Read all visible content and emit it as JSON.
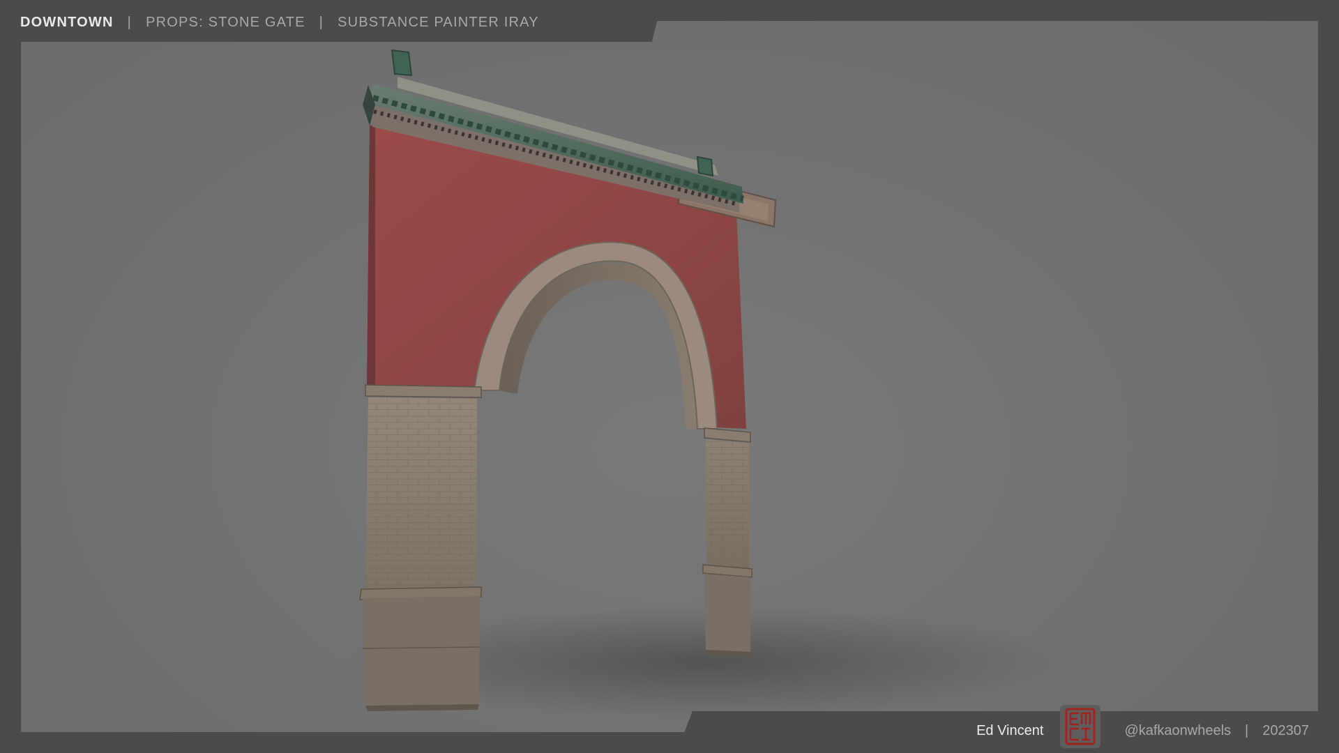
{
  "header": {
    "project": "DOWNTOWN",
    "separator": "|",
    "category": "PROPS: STONE GATE",
    "renderer": "SUBSTANCE PAINTER IRAY"
  },
  "footer": {
    "author": "Ed Vincent",
    "separator": "|",
    "handle": "@kafkaonwheels",
    "date": "202307",
    "seal_icon": "seal-logo-icon"
  },
  "scene": {
    "subject": "stone-gate-arch",
    "plaque_text": "",
    "colors": {
      "frame": "#4b4b4b",
      "background": "#727272",
      "red_wall": "#8e4745",
      "stone": "#8f8173",
      "roof_tile": "#3f6f5a",
      "seal_red": "#a2221f"
    }
  }
}
